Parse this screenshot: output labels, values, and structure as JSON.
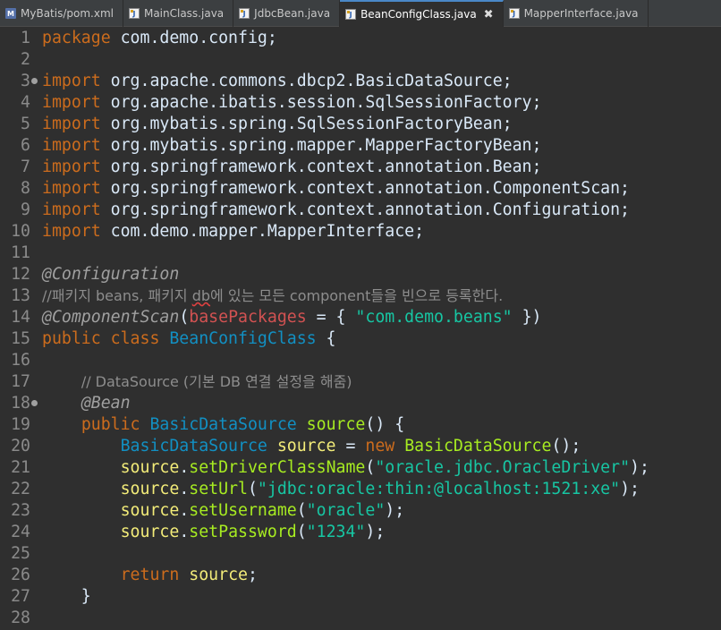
{
  "tabs": [
    {
      "name": "tab-pom-xml",
      "icon": "xml-file-icon",
      "icon_glyph": "M",
      "label": "MyBatis/pom.xml",
      "active": false
    },
    {
      "name": "tab-mainclass",
      "icon": "java-file-icon",
      "icon_glyph": "J",
      "label": "MainClass.java",
      "active": false
    },
    {
      "name": "tab-jdbcbean",
      "icon": "java-file-icon",
      "icon_glyph": "J",
      "label": "JdbcBean.java",
      "active": false
    },
    {
      "name": "tab-beanconfigclass",
      "icon": "java-file-icon",
      "icon_glyph": "J",
      "label": "BeanConfigClass.java",
      "active": true,
      "close": "✖"
    },
    {
      "name": "tab-mapperinterface",
      "icon": "java-file-icon",
      "icon_glyph": "J",
      "label": "MapperInterface.java",
      "active": false
    }
  ],
  "editor": {
    "lines": [
      {
        "n": "1",
        "tokens": [
          [
            "kw",
            "package"
          ],
          [
            "pl",
            " com.demo.config;"
          ]
        ]
      },
      {
        "n": "2",
        "tokens": []
      },
      {
        "n": "3",
        "marker": true,
        "tokens": [
          [
            "kw",
            "import"
          ],
          [
            "pl",
            " org.apache.commons.dbcp2.BasicDataSource;"
          ]
        ]
      },
      {
        "n": "4",
        "tokens": [
          [
            "kw",
            "import"
          ],
          [
            "pl",
            " org.apache.ibatis.session.SqlSessionFactory;"
          ]
        ]
      },
      {
        "n": "5",
        "tokens": [
          [
            "kw",
            "import"
          ],
          [
            "pl",
            " org.mybatis.spring.SqlSessionFactoryBean;"
          ]
        ]
      },
      {
        "n": "6",
        "tokens": [
          [
            "kw",
            "import"
          ],
          [
            "pl",
            " org.mybatis.spring.mapper.MapperFactoryBean;"
          ]
        ]
      },
      {
        "n": "7",
        "tokens": [
          [
            "kw",
            "import"
          ],
          [
            "pl",
            " org.springframework.context.annotation.Bean;"
          ]
        ]
      },
      {
        "n": "8",
        "tokens": [
          [
            "kw",
            "import"
          ],
          [
            "pl",
            " org.springframework.context.annotation.ComponentScan;"
          ]
        ]
      },
      {
        "n": "9",
        "tokens": [
          [
            "kw",
            "import"
          ],
          [
            "pl",
            " org.springframework.context.annotation.Configuration;"
          ]
        ]
      },
      {
        "n": "10",
        "tokens": [
          [
            "kw",
            "import"
          ],
          [
            "pl",
            " com.demo.mapper.MapperInterface;"
          ]
        ]
      },
      {
        "n": "11",
        "tokens": []
      },
      {
        "n": "12",
        "tokens": [
          [
            "an",
            "@Configuration"
          ]
        ]
      },
      {
        "n": "13",
        "tokens": [
          [
            "cm",
            "//패키지 beans, 패키지 "
          ],
          [
            "cmsq",
            "db"
          ],
          [
            "cm",
            "에 있는 모든 component들을 빈으로 등록한다."
          ]
        ]
      },
      {
        "n": "14",
        "tokens": [
          [
            "an",
            "@ComponentScan"
          ],
          [
            "pl",
            "("
          ],
          [
            "at",
            "basePackages"
          ],
          [
            "pl",
            " = { "
          ],
          [
            "st",
            "\"com.demo.beans\""
          ],
          [
            "pl",
            " })"
          ]
        ]
      },
      {
        "n": "15",
        "tokens": [
          [
            "kw",
            "public"
          ],
          [
            "pl",
            " "
          ],
          [
            "kw",
            "class"
          ],
          [
            "pl",
            " "
          ],
          [
            "ty",
            "BeanConfigClass"
          ],
          [
            "pl",
            " {"
          ]
        ]
      },
      {
        "n": "16",
        "tokens": []
      },
      {
        "n": "17",
        "tokens": [
          [
            "pl",
            "    "
          ],
          [
            "cm",
            "// DataSource (기본 DB 연결 설정을 해줌)"
          ]
        ]
      },
      {
        "n": "18",
        "marker": true,
        "tokens": [
          [
            "pl",
            "    "
          ],
          [
            "an",
            "@Bean"
          ]
        ]
      },
      {
        "n": "19",
        "tokens": [
          [
            "pl",
            "    "
          ],
          [
            "kw",
            "public"
          ],
          [
            "pl",
            " "
          ],
          [
            "ty",
            "BasicDataSource"
          ],
          [
            "pl",
            " "
          ],
          [
            "mt",
            "source"
          ],
          [
            "pl",
            "() {"
          ]
        ]
      },
      {
        "n": "20",
        "tokens": [
          [
            "pl",
            "        "
          ],
          [
            "ty",
            "BasicDataSource"
          ],
          [
            "pl",
            " "
          ],
          [
            "vr",
            "source"
          ],
          [
            "pl",
            " = "
          ],
          [
            "kw",
            "new"
          ],
          [
            "pl",
            " "
          ],
          [
            "mt",
            "BasicDataSource"
          ],
          [
            "pl",
            "();"
          ]
        ]
      },
      {
        "n": "21",
        "tokens": [
          [
            "pl",
            "        "
          ],
          [
            "vr",
            "source"
          ],
          [
            "pl",
            "."
          ],
          [
            "mt",
            "setDriverClassName"
          ],
          [
            "pl",
            "("
          ],
          [
            "st",
            "\"oracle.jdbc.OracleDriver\""
          ],
          [
            "pl",
            ");"
          ]
        ]
      },
      {
        "n": "22",
        "tokens": [
          [
            "pl",
            "        "
          ],
          [
            "vr",
            "source"
          ],
          [
            "pl",
            "."
          ],
          [
            "mt",
            "setUrl"
          ],
          [
            "pl",
            "("
          ],
          [
            "st",
            "\"jdbc:oracle:thin:@localhost:1521:xe\""
          ],
          [
            "pl",
            ");"
          ]
        ]
      },
      {
        "n": "23",
        "tokens": [
          [
            "pl",
            "        "
          ],
          [
            "vr",
            "source"
          ],
          [
            "pl",
            "."
          ],
          [
            "mt",
            "setUsername"
          ],
          [
            "pl",
            "("
          ],
          [
            "st",
            "\"oracle\""
          ],
          [
            "pl",
            ");"
          ]
        ]
      },
      {
        "n": "24",
        "tokens": [
          [
            "pl",
            "        "
          ],
          [
            "vr",
            "source"
          ],
          [
            "pl",
            "."
          ],
          [
            "mt",
            "setPassword"
          ],
          [
            "pl",
            "("
          ],
          [
            "st",
            "\"1234\""
          ],
          [
            "pl",
            ");"
          ]
        ]
      },
      {
        "n": "25",
        "tokens": []
      },
      {
        "n": "26",
        "tokens": [
          [
            "pl",
            "        "
          ],
          [
            "kw",
            "return"
          ],
          [
            "pl",
            " "
          ],
          [
            "vr",
            "source"
          ],
          [
            "pl",
            ";"
          ]
        ]
      },
      {
        "n": "27",
        "tokens": [
          [
            "pl",
            "    }"
          ]
        ]
      },
      {
        "n": "28",
        "tokens": []
      }
    ]
  }
}
